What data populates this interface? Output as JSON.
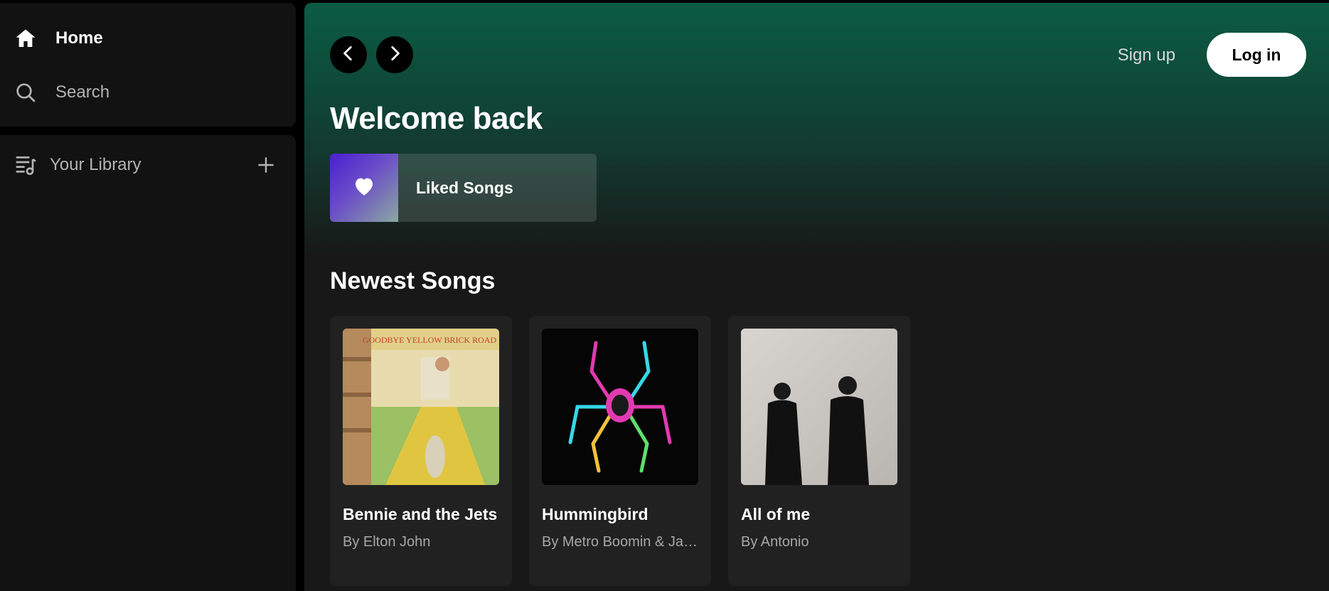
{
  "sidebar": {
    "nav": [
      {
        "label": "Home",
        "icon": "home-icon"
      },
      {
        "label": "Search",
        "icon": "search-icon"
      }
    ],
    "library": {
      "label": "Your Library",
      "icon": "library-icon",
      "add_icon": "plus-icon"
    }
  },
  "header": {
    "back_icon": "chevron-left-icon",
    "forward_icon": "chevron-right-icon",
    "signup_label": "Sign up",
    "login_label": "Log in"
  },
  "main": {
    "welcome": "Welcome back",
    "liked": {
      "label": "Liked Songs",
      "icon": "heart-icon"
    },
    "section_title": "Newest Songs",
    "songs": [
      {
        "title": "Bennie and the Jets",
        "artist": "By Elton John"
      },
      {
        "title": "Hummingbird",
        "artist": "By Metro Boomin & James Blake"
      },
      {
        "title": "All of me",
        "artist": "By Antonio"
      }
    ]
  },
  "colors": {
    "accent_green": "#0b5c44",
    "background": "#121212",
    "card": "#212121",
    "text_muted": "#b3b3b3"
  }
}
